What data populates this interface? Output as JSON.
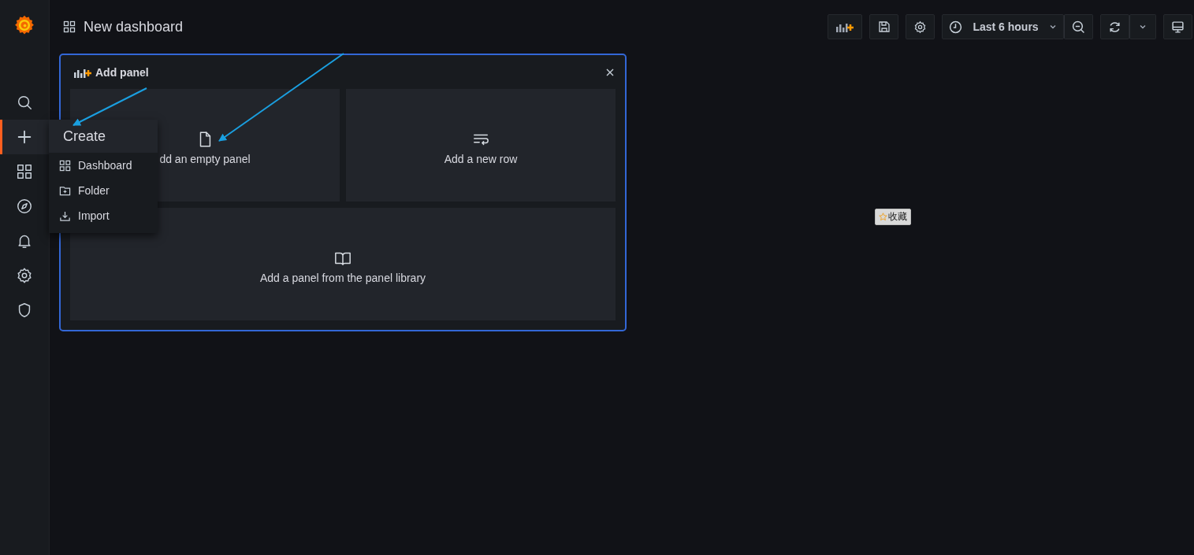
{
  "sidebar": {
    "items": [
      {
        "kind": "search",
        "selected": false
      },
      {
        "kind": "create",
        "selected": true
      },
      {
        "kind": "dashboards",
        "selected": false
      },
      {
        "kind": "explore",
        "selected": false
      },
      {
        "kind": "alerting",
        "selected": false
      },
      {
        "kind": "configuration",
        "selected": false
      },
      {
        "kind": "admin",
        "selected": false
      }
    ]
  },
  "top_bar": {
    "title": "New dashboard",
    "time_range": "Last 6 hours"
  },
  "add_panel": {
    "title": "Add panel",
    "options": [
      {
        "kind": "empty",
        "label": "dd an empty panel"
      },
      {
        "kind": "row",
        "label": "Add a new row"
      },
      {
        "kind": "library",
        "label": "Add a panel from the panel library"
      }
    ]
  },
  "create_menu": {
    "title": "Create",
    "items": [
      {
        "kind": "dashboard",
        "label": "Dashboard"
      },
      {
        "kind": "folder",
        "label": "Folder"
      },
      {
        "kind": "import",
        "label": "Import"
      }
    ]
  },
  "bookmark_badge": {
    "label": "收藏"
  }
}
